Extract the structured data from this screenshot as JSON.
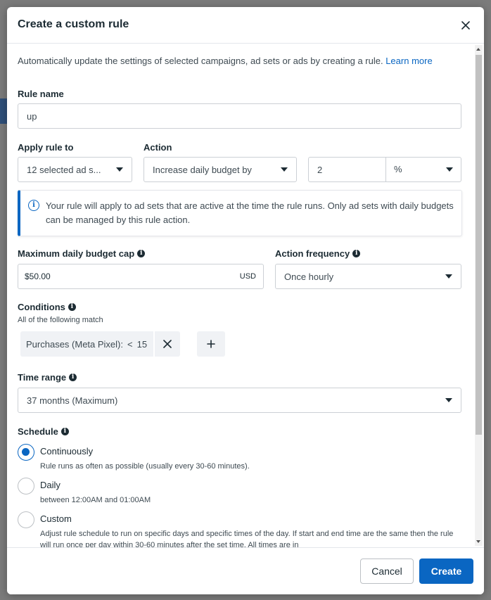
{
  "dialog": {
    "title": "Create a custom rule",
    "intro_text": "Automatically update the settings of selected campaigns, ad sets or ads by creating a rule.",
    "learn_more": "Learn more"
  },
  "rule_name": {
    "label": "Rule name",
    "value": "up"
  },
  "apply_rule_to": {
    "label": "Apply rule to",
    "value": "12 selected ad s..."
  },
  "action": {
    "label": "Action",
    "value": "Increase daily budget by",
    "amount": "2",
    "unit": "%"
  },
  "notice": {
    "text": "Your rule will apply to ad sets that are active at the time the rule runs. Only ad sets with daily budgets can be managed by this rule action."
  },
  "max_budget_cap": {
    "label": "Maximum daily budget cap",
    "value": "$50.00",
    "currency": "USD"
  },
  "action_frequency": {
    "label": "Action frequency",
    "value": "Once hourly"
  },
  "conditions": {
    "label": "Conditions",
    "sublabel": "All of the following match",
    "items": [
      {
        "metric": "Purchases (Meta Pixel):",
        "operator": "<",
        "value": "15"
      }
    ]
  },
  "time_range": {
    "label": "Time range",
    "value": "37 months (Maximum)"
  },
  "schedule": {
    "label": "Schedule",
    "options": [
      {
        "title": "Continuously",
        "desc": "Rule runs as often as possible (usually every 30-60 minutes).",
        "checked": true
      },
      {
        "title": "Daily",
        "desc": "between 12:00AM and 01:00AM",
        "checked": false
      },
      {
        "title": "Custom",
        "desc": "Adjust rule schedule to run on specific days and specific times of the day. If start and end time are the same then the rule will run once per day within 30-60 minutes after the set time. All times are in",
        "checked": false
      }
    ]
  },
  "footer": {
    "cancel": "Cancel",
    "create": "Create"
  },
  "colors": {
    "accent": "#0a66c2",
    "text": "#1c2b33",
    "border": "#ccd0d5"
  }
}
